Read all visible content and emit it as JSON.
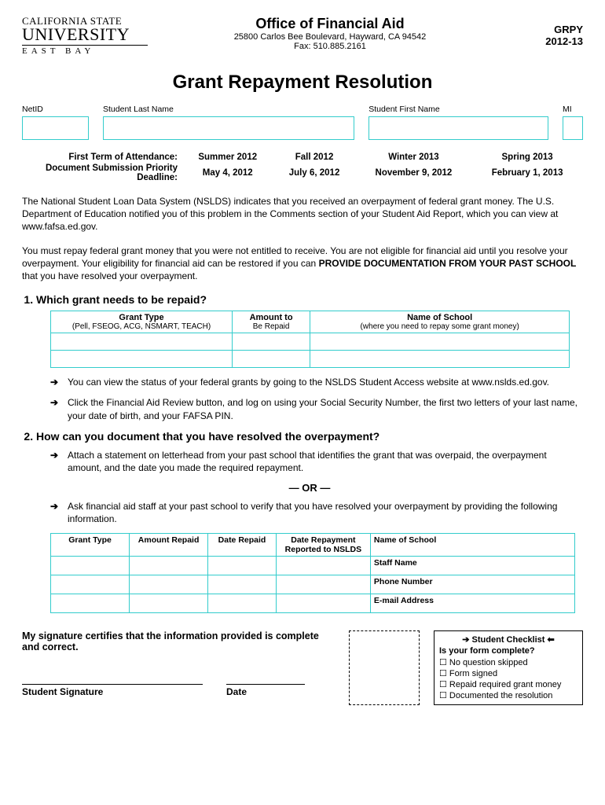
{
  "university": {
    "line1": "CALIFORNIA STATE",
    "line2": "UNIVERSITY",
    "line3": "EAST BAY"
  },
  "header": {
    "office": "Office of Financial Aid",
    "address": "25800 Carlos Bee Boulevard, Hayward, CA 94542",
    "fax": "Fax:  510.885.2161",
    "code": "GRPY",
    "year": "2012-13"
  },
  "title": "Grant Repayment Resolution",
  "fields": {
    "netid": "NetID",
    "lname": "Student Last Name",
    "fname": "Student First Name",
    "mi": "MI"
  },
  "terms": {
    "row1_label": "First Term of Attendance:",
    "row2_label": "Document Submission Priority Deadline:",
    "cols": [
      {
        "term": "Summer  2012",
        "deadline": "May 4, 2012"
      },
      {
        "term": "Fall 2012",
        "deadline": "July 6, 2012"
      },
      {
        "term": "Winter  2013",
        "deadline": "November 9, 2012"
      },
      {
        "term": "Spring 2013",
        "deadline": "February 1, 2013"
      }
    ]
  },
  "para1": "The National Student Loan Data System (NSLDS) indicates that you received an overpayment of federal grant money. The U.S. Department of Education notified you of this problem in the Comments section of your Student Aid Report, which you can view at www.fafsa.ed.gov.",
  "para2a": "You must repay federal grant money that you were not entitled to receive. You are not eligible for financial aid until you resolve your overpayment. Your eligibility for financial aid can be restored if you can ",
  "para2b": "PROVIDE DOCUMENTATION FROM YOUR PAST SCHOOL",
  "para2c": " that you have resolved your overpayment.",
  "q1": {
    "title": "Which grant needs to be repaid?",
    "headers": {
      "c1": "Grant Type",
      "c1sub": "(Pell, FSEOG, ACG, NSMART, TEACH)",
      "c2": "Amount to",
      "c2sub": "Be Repaid",
      "c3": "Name of School",
      "c3sub": "(where you need to repay some grant money)"
    },
    "bullets": [
      "You can view the status of your federal grants by going to the NSLDS Student Access website at www.nslds.ed.gov.",
      "Click the Financial Aid Review button, and log on using your Social Security Number, the first two letters of your last name, your date of birth, and your FAFSA PIN."
    ]
  },
  "q2": {
    "title": "How can you document that you have resolved the overpayment?",
    "bullet1": "Attach a statement on letterhead from your past school that identifies the grant that was overpaid, the overpayment amount, and the date you made the required repayment.",
    "or": "— OR —",
    "bullet2": "Ask financial aid staff at your past school to verify that you have resolved your overpayment by providing the following information.",
    "headers": {
      "c1": "Grant Type",
      "c2": "Amount Repaid",
      "c3": "Date Repaid",
      "c4": "Date Repayment Reported to NSLDS",
      "c5a": "Name of School",
      "c5b": "Staff Name",
      "c5c": "Phone Number",
      "c5d": "E-mail Address"
    }
  },
  "sig": {
    "text": "My signature certifies that the information provided is complete and correct.",
    "sig_label": "Student Signature",
    "date_label": "Date"
  },
  "checklist": {
    "head": "Student Checklist",
    "sub": "Is your form complete?",
    "items": [
      "No question skipped",
      "Form signed",
      "Repaid required grant money",
      "Documented the resolution"
    ]
  }
}
